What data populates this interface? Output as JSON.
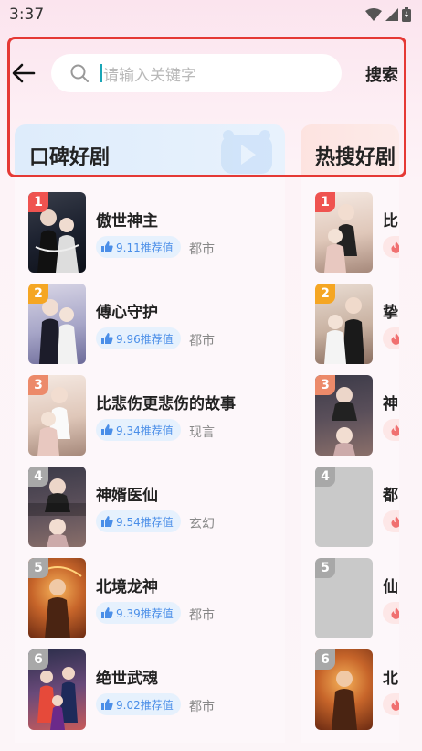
{
  "status_bar": {
    "time": "3:37"
  },
  "header": {
    "search_placeholder": "请输入关键字",
    "search_button": "搜索"
  },
  "tabs": [
    {
      "label": "口碑好剧"
    },
    {
      "label": "热搜好剧"
    }
  ],
  "reputation_list": [
    {
      "rank": "1",
      "title": "傲世神主",
      "score": "9.11推荐值",
      "genre": "都市"
    },
    {
      "rank": "2",
      "title": "傅心守护",
      "score": "9.96推荐值",
      "genre": "都市"
    },
    {
      "rank": "3",
      "title": "比悲伤更悲伤的故事",
      "score": "9.34推荐值",
      "genre": "现言"
    },
    {
      "rank": "4",
      "title": "神婿医仙",
      "score": "9.54推荐值",
      "genre": "玄幻"
    },
    {
      "rank": "5",
      "title": "北境龙神",
      "score": "9.39推荐值",
      "genre": "都市"
    },
    {
      "rank": "6",
      "title": "绝世武魂",
      "score": "9.02推荐值",
      "genre": "都市"
    }
  ],
  "hot_list": [
    {
      "rank": "1",
      "title": "比"
    },
    {
      "rank": "2",
      "title": "挚"
    },
    {
      "rank": "3",
      "title": "神"
    },
    {
      "rank": "4",
      "title": "都"
    },
    {
      "rank": "5",
      "title": "仙"
    },
    {
      "rank": "6",
      "title": "北"
    }
  ],
  "colors": {
    "rank1": "#ef5350",
    "rank2": "#f5a623",
    "rank3": "#ec8a6a",
    "rank_other": "#a8a8a8",
    "highlight": "#e53935",
    "score_badge": "#4a8ee8",
    "hot_badge": "#f07070"
  }
}
